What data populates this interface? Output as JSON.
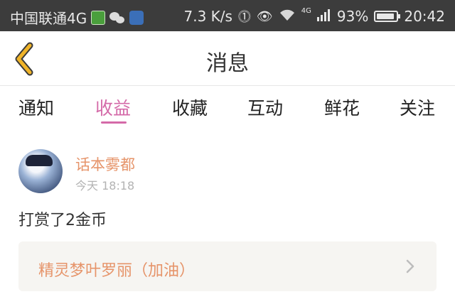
{
  "status_bar": {
    "carrier": "中国联通4G",
    "speed": "7.3 K/s",
    "network": "4G",
    "battery": "93%",
    "battery_level": 0.93,
    "time": "20:42"
  },
  "header": {
    "title": "消息"
  },
  "tabs": [
    {
      "label": "通知",
      "active": false
    },
    {
      "label": "收益",
      "active": true
    },
    {
      "label": "收藏",
      "active": false
    },
    {
      "label": "互动",
      "active": false
    },
    {
      "label": "鲜花",
      "active": false
    },
    {
      "label": "关注",
      "active": false
    }
  ],
  "message": {
    "sender": "话本雾都",
    "time": "今天 18:18",
    "text": "打赏了2金币",
    "link_title": "精灵梦叶罗丽（加油）"
  },
  "colors": {
    "accent": "#d46aa8",
    "sender": "#e6946a",
    "status_bar_bg": "#3c3c3c",
    "back_icon": "#f0b429"
  }
}
